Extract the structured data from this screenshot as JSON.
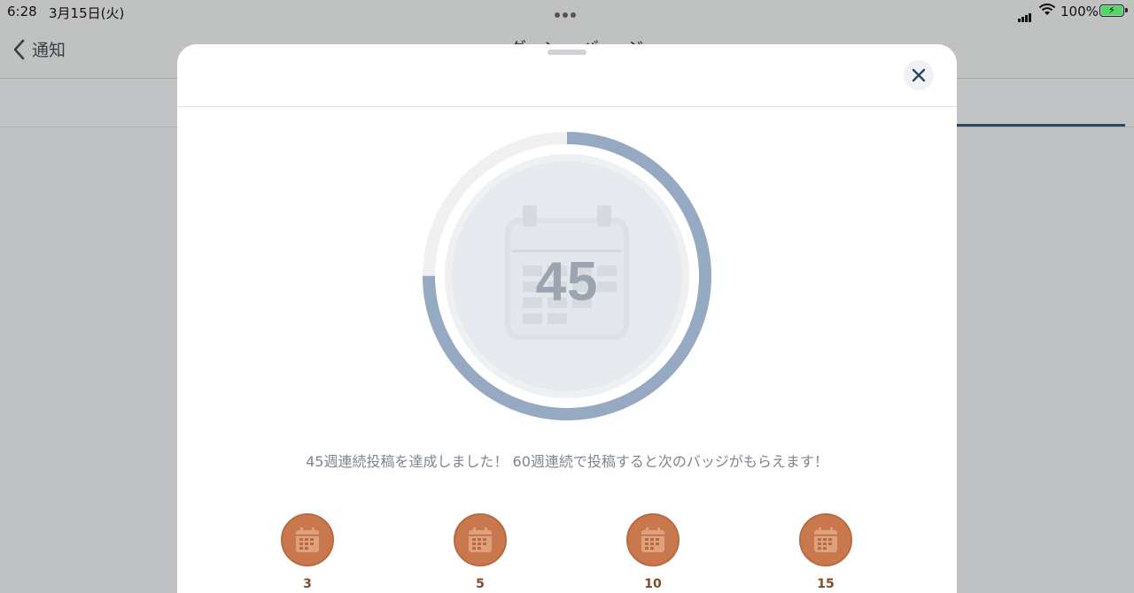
{
  "status_bar": {
    "time": "6:28",
    "date": "3月15日(火)",
    "battery_percent": "100%"
  },
  "nav": {
    "back_label": "通知",
    "title": "グ・ン・ バ ・ ジ"
  },
  "badge": {
    "count": "45",
    "progress_fraction": 0.75,
    "ring_color": "#96a9c3",
    "track_color": "#eef0f2"
  },
  "message": "45週連続投稿を達成しました！ 60週連続で投稿すると次のバッジがもらえます！",
  "badges": [
    {
      "label": "3"
    },
    {
      "label": "5"
    },
    {
      "label": "10"
    },
    {
      "label": "15"
    }
  ],
  "colors": {
    "medal_bronze": "#c9774d",
    "accent_navy": "#2e4566"
  }
}
